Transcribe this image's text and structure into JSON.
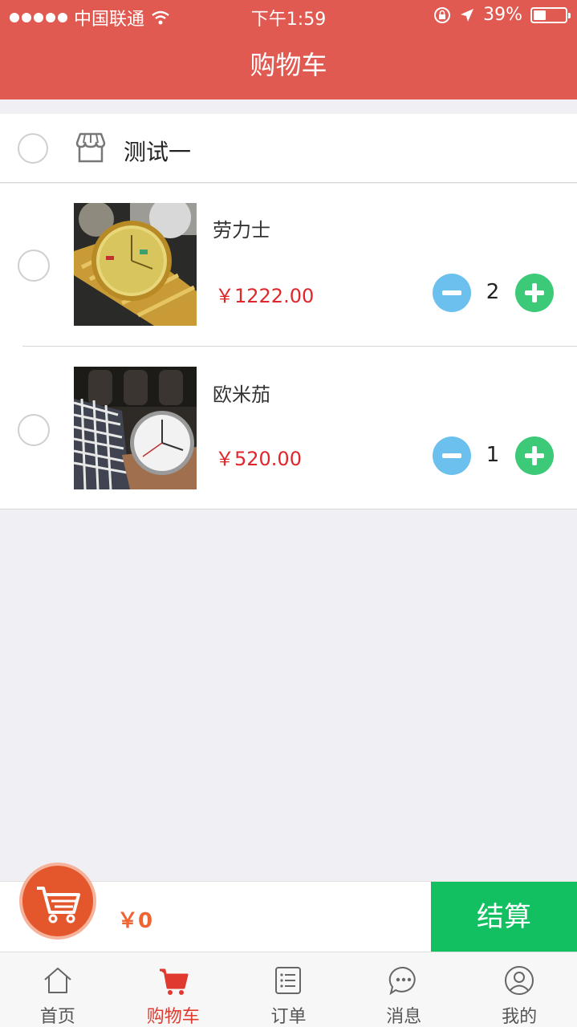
{
  "status_bar": {
    "carrier": "中国联通",
    "time": "下午1:59",
    "battery": "39%"
  },
  "header": {
    "title": "购物车"
  },
  "store": {
    "name": "测试一",
    "icon": "store-icon"
  },
  "items": [
    {
      "name": "劳力士",
      "price": "￥1222.00",
      "quantity": "2",
      "image": "gold-watch"
    },
    {
      "name": "欧米茄",
      "price": "￥520.00",
      "quantity": "1",
      "image": "silver-watch"
    }
  ],
  "checkout": {
    "total": "￥0",
    "button_label": "结算"
  },
  "tabbar": [
    {
      "label": "首页",
      "icon": "home-icon"
    },
    {
      "label": "购物车",
      "icon": "cart-icon",
      "active": true
    },
    {
      "label": "订单",
      "icon": "list-icon"
    },
    {
      "label": "消息",
      "icon": "chat-icon"
    },
    {
      "label": "我的",
      "icon": "user-icon"
    }
  ],
  "colors": {
    "header": "#e05a52",
    "price": "#e0262b",
    "minus": "#6cc0ee",
    "plus": "#3cc978",
    "settle": "#12c062",
    "total": "#ef6432",
    "active_tab": "#e0392f"
  }
}
